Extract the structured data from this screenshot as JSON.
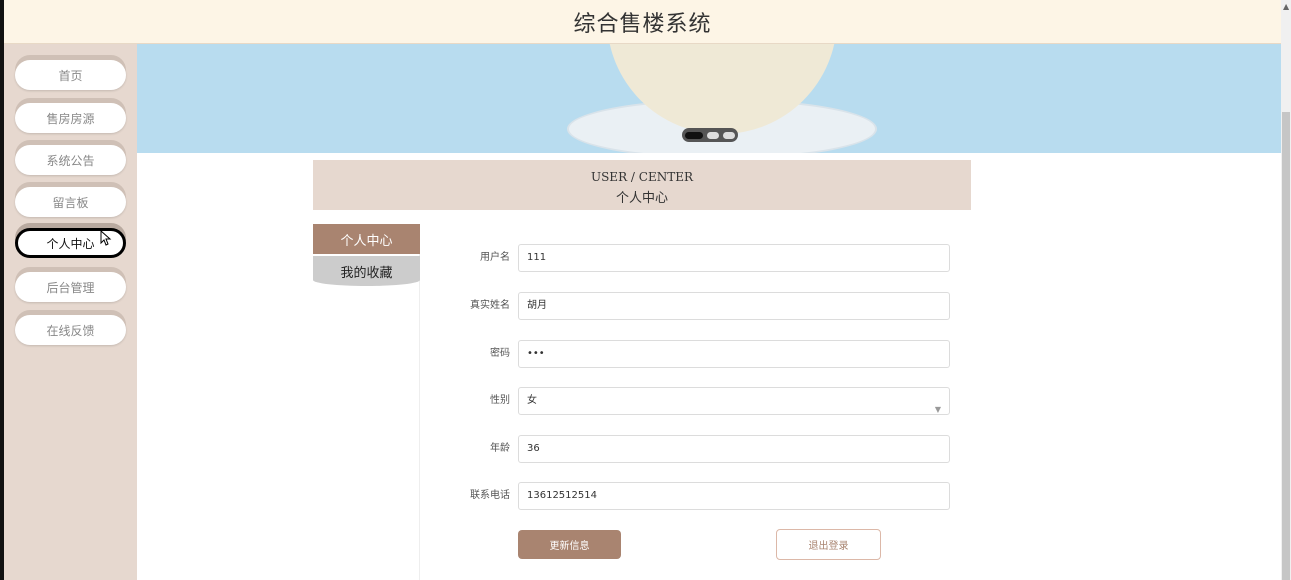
{
  "app": {
    "title": "综合售楼系统"
  },
  "sidebar": {
    "items": [
      {
        "label": "首页"
      },
      {
        "label": "售房房源"
      },
      {
        "label": "系统公告"
      },
      {
        "label": "留言板"
      },
      {
        "label": "个人中心"
      },
      {
        "label": "后台管理"
      },
      {
        "label": "在线反馈"
      }
    ]
  },
  "user_center": {
    "title_en": "USER / CENTER",
    "title_cn": "个人中心",
    "tabs": [
      {
        "label": "个人中心"
      },
      {
        "label": "我的收藏"
      }
    ],
    "form": {
      "username": {
        "label": "用户名",
        "value": "111"
      },
      "realname": {
        "label": "真实姓名",
        "value": "胡月"
      },
      "password": {
        "label": "密码",
        "value": "•••"
      },
      "gender": {
        "label": "性别",
        "value": "女"
      },
      "age": {
        "label": "年龄",
        "value": "36"
      },
      "phone": {
        "label": "联系电话",
        "value": "13612512514"
      }
    },
    "update_button": "更新信息",
    "logout_button": "退出登录"
  }
}
